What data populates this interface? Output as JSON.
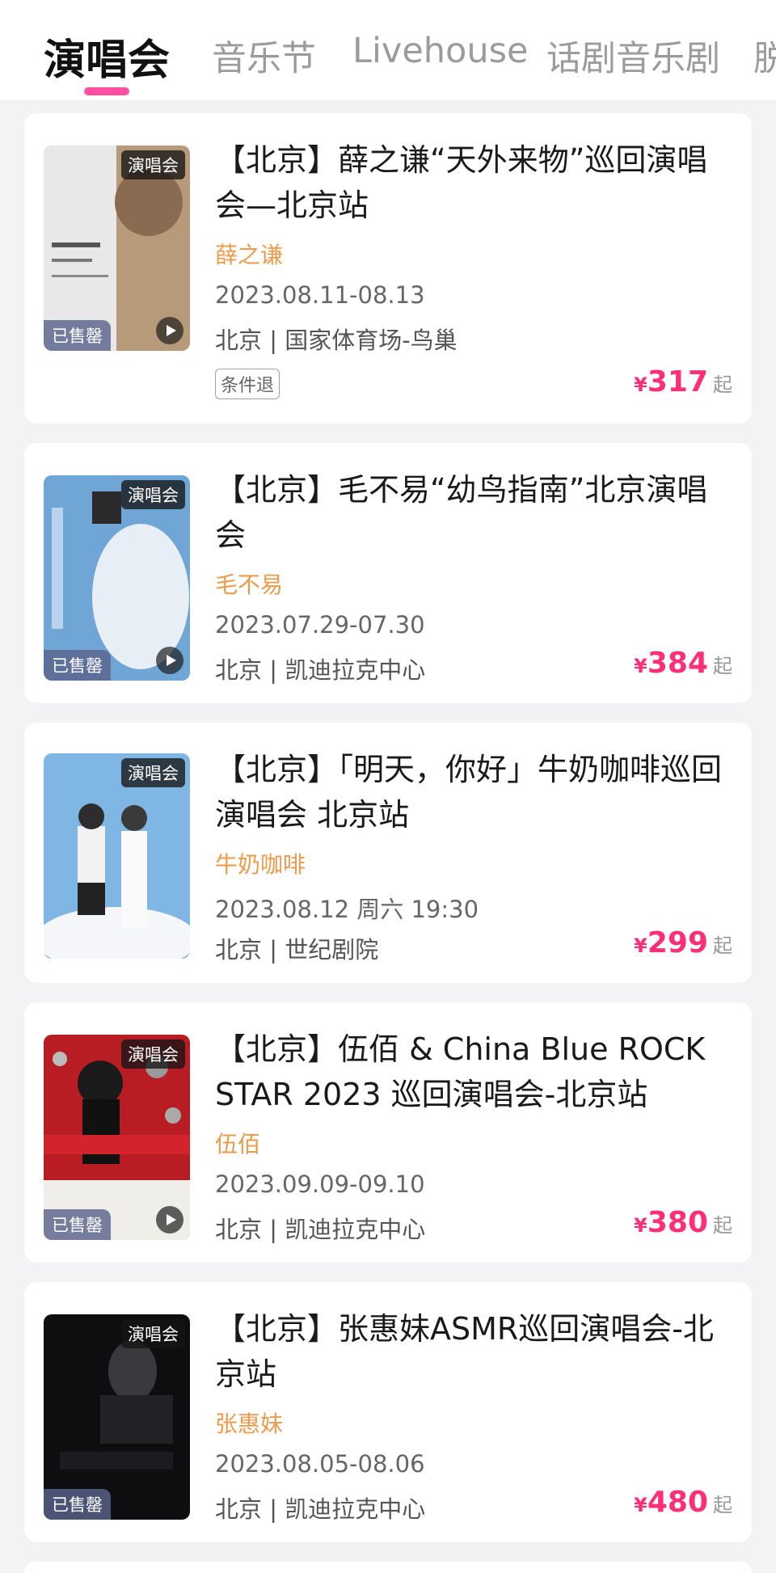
{
  "tabs": [
    {
      "label": "演唱会",
      "active": true
    },
    {
      "label": "音乐节",
      "active": false
    },
    {
      "label": "Livehouse",
      "active": false
    },
    {
      "label": "话剧音乐剧",
      "active": false
    },
    {
      "label": "脱",
      "active": false
    }
  ],
  "badges": {
    "type": "演唱会",
    "sold_out": "已售罄"
  },
  "price_suffix": "起",
  "currency": "¥",
  "colors": {
    "accent": "#ff2e79",
    "artist": "#ee9a4a",
    "indicator": "#ff4fa0"
  },
  "events": [
    {
      "title": "【北京】薛之谦“天外来物”巡回演唱会—北京站",
      "artist": "薛之谦",
      "date": "2023.08.11-08.13",
      "venue": "北京 | 国家体育场-鸟巢",
      "tag": "条件退",
      "price": "317",
      "sold_out": true,
      "has_video": true
    },
    {
      "title": "【北京】毛不易“幼鸟指南”北京演唱会",
      "artist": "毛不易",
      "date": "2023.07.29-07.30",
      "venue": "北京 | 凯迪拉克中心",
      "price": "384",
      "sold_out": true,
      "has_video": true
    },
    {
      "title": "【北京】「明天，你好」牛奶咖啡巡回演唱会 北京站",
      "artist": "牛奶咖啡",
      "date": "2023.08.12 周六 19:30",
      "venue": "北京 | 世纪剧院",
      "price": "299",
      "sold_out": false,
      "has_video": false
    },
    {
      "title": "【北京】伍佰 & China Blue ROCK STAR 2023 巡回演唱会-北京站",
      "artist": "伍佰",
      "date": "2023.09.09-09.10",
      "venue": "北京 | 凯迪拉克中心",
      "price": "380",
      "sold_out": true,
      "has_video": true
    },
    {
      "title": "【北京】张惠妹ASMR巡回演唱会-北京站",
      "artist": "张惠妹",
      "date": "2023.08.05-08.06",
      "venue": "北京 | 凯迪拉克中心",
      "price": "480",
      "sold_out": true,
      "has_video": false
    }
  ]
}
